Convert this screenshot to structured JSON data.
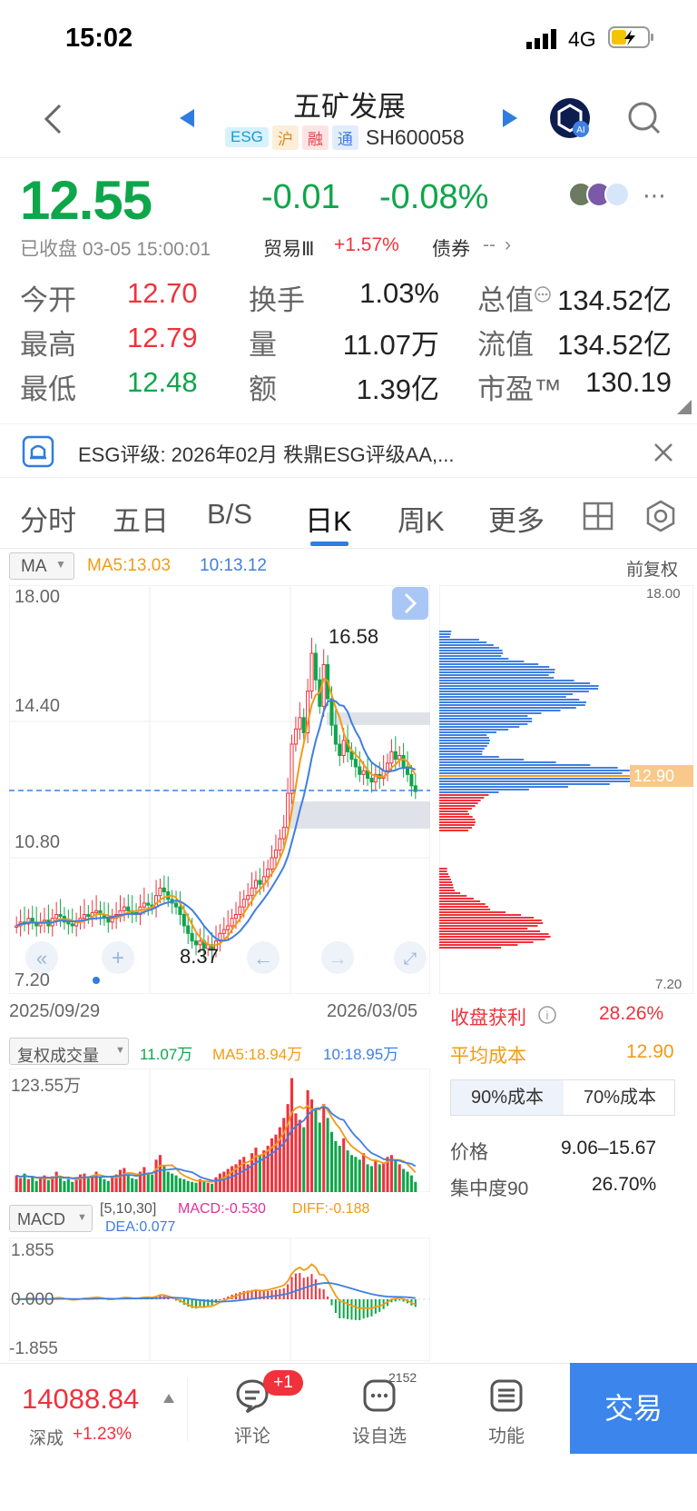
{
  "status_bar": {
    "time": "15:02",
    "network": "4G"
  },
  "header": {
    "title": "五矿发展",
    "tags": [
      "ESG",
      "沪",
      "融",
      "通"
    ],
    "code": "SH600058"
  },
  "quote": {
    "price": "12.55",
    "change": "-0.01",
    "change_pct": "-0.08%",
    "status": "已收盘 03-05 15:00:01",
    "sector_name": "贸易Ⅲ",
    "sector_change": "+1.57%",
    "bond_label": "债券",
    "bond_value": "--",
    "open_label": "今开",
    "open": "12.70",
    "high_label": "最高",
    "high": "12.79",
    "low_label": "最低",
    "low": "12.48",
    "turnover_label": "换手",
    "turnover": "1.03%",
    "volume_label": "量",
    "volume": "11.07万",
    "amount_label": "额",
    "amount": "1.39亿",
    "mktcap_label": "总值",
    "mktcap": "134.52亿",
    "float_label": "流值",
    "float_cap": "134.52亿",
    "pe_label": "市盈™",
    "pe": "130.19"
  },
  "esg_notice": "ESG评级: 2026年02月 秩鼎ESG评级AA,...",
  "tabs": [
    "分时",
    "五日",
    "B/S",
    "日K",
    "周K",
    "更多"
  ],
  "chart_header": {
    "indicator": "MA",
    "ma5": "MA5:13.03",
    "ma10": "10:13.12",
    "adjust": "前复权"
  },
  "price_axis": [
    "18.00",
    "14.40",
    "10.80",
    "7.20"
  ],
  "price_labels": {
    "peak": "16.58",
    "trough": "8.37"
  },
  "date_start": "2025/09/29",
  "date_end": "2026/03/05",
  "volume_header": {
    "label": "复权成交量",
    "vol": "11.07万",
    "ma5": "MA5:18.94万",
    "ma10": "10:18.95万",
    "max": "123.55万"
  },
  "macd_header": {
    "label": "MACD",
    "params": "[5,10,30]",
    "macd": "MACD:-0.530",
    "diff": "DIFF:-0.188",
    "dea": "DEA:0.077"
  },
  "macd_axis": [
    "1.855",
    "0.000",
    "-1.855"
  ],
  "chips": {
    "axis_top": "18.00",
    "axis_bottom": "7.20",
    "avg_marker": "12.90",
    "profit_label": "收盘获利",
    "profit_value": "28.26%",
    "avg_cost_label": "平均成本",
    "avg_cost_value": "12.90",
    "tab90": "90%成本",
    "tab70": "70%成本",
    "price_label": "价格",
    "price_range": "9.06–15.67",
    "conc_label": "集中度90",
    "conc_value": "26.70%"
  },
  "bottom_bar": {
    "index_value": "14088.84",
    "index_name": "深成",
    "index_change": "+1.23%",
    "comment_label": "评论",
    "comment_badge": "+1",
    "watch_label": "设自选",
    "watch_count": "2152",
    "func_label": "功能",
    "trade_label": "交易"
  },
  "chart_data": {
    "type": "candlestick",
    "x_start": "2025/09/29",
    "x_end": "2026/03/05",
    "ylim": [
      7.2,
      18.0
    ],
    "annotations": {
      "high": 16.58,
      "low": 8.37
    },
    "close": [
      9.0,
      9.1,
      9.05,
      9.2,
      9.1,
      9.0,
      9.1,
      9.15,
      9.0,
      9.2,
      9.3,
      9.25,
      9.1,
      9.05,
      9.0,
      9.1,
      9.2,
      9.3,
      9.25,
      9.35,
      9.4,
      9.3,
      9.2,
      9.1,
      9.2,
      9.3,
      9.4,
      9.5,
      9.4,
      9.35,
      9.3,
      9.5,
      9.6,
      9.55,
      9.5,
      9.8,
      10.0,
      9.9,
      9.7,
      9.6,
      9.5,
      9.3,
      9.0,
      8.8,
      8.6,
      8.5,
      8.6,
      8.4,
      8.5,
      8.37,
      8.6,
      8.8,
      8.9,
      9.0,
      9.2,
      9.3,
      9.5,
      9.7,
      9.8,
      10.0,
      10.2,
      10.1,
      10.3,
      10.5,
      10.8,
      11.0,
      11.3,
      11.6,
      12.5,
      13.8,
      14.2,
      14.5,
      14.1,
      15.2,
      16.2,
      15.5,
      14.8,
      15.9,
      15.0,
      14.3,
      13.8,
      13.5,
      13.9,
      13.6,
      13.4,
      13.2,
      13.0,
      13.1,
      12.9,
      12.8,
      13.0,
      12.9,
      13.1,
      13.3,
      13.6,
      13.4,
      13.5,
      13.2,
      13.0,
      12.7,
      12.55
    ],
    "ma5": 13.03,
    "ma10": 13.12,
    "volume_max": 123.55,
    "volume": [
      18,
      15,
      20,
      14,
      16,
      12,
      15,
      18,
      13,
      17,
      22,
      15,
      12,
      14,
      11,
      16,
      19,
      20,
      15,
      18,
      22,
      17,
      14,
      12,
      16,
      19,
      24,
      26,
      18,
      15,
      14,
      22,
      27,
      21,
      19,
      35,
      40,
      28,
      22,
      20,
      18,
      15,
      14,
      12,
      11,
      10,
      14,
      12,
      10,
      9,
      16,
      20,
      22,
      25,
      28,
      30,
      35,
      38,
      30,
      42,
      48,
      40,
      45,
      50,
      58,
      62,
      70,
      80,
      95,
      123,
      85,
      78,
      70,
      110,
      100,
      90,
      75,
      95,
      80,
      65,
      55,
      50,
      58,
      45,
      40,
      38,
      35,
      42,
      30,
      28,
      35,
      30,
      32,
      38,
      40,
      34,
      30,
      25,
      22,
      18,
      11
    ],
    "macd_range": [
      -1.855,
      1.855
    ],
    "macd": {
      "macd": -0.53,
      "diff": -0.188,
      "dea": 0.077
    }
  }
}
